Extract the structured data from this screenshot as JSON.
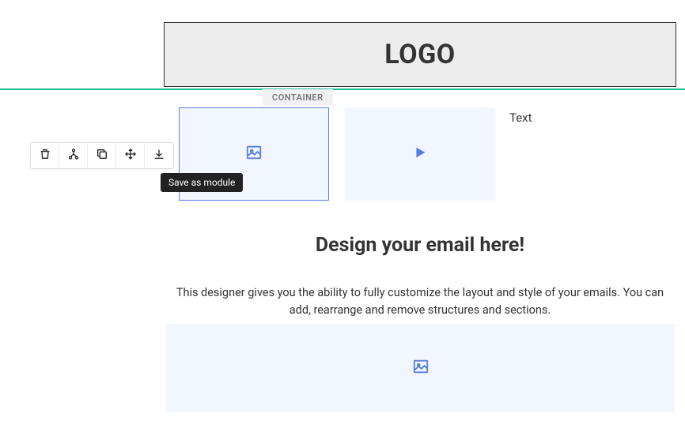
{
  "logo": {
    "text": "LOGO"
  },
  "selection": {
    "tag": "CONTAINER"
  },
  "blocks": {
    "image_icon": "image-icon",
    "video_icon": "play-icon",
    "text_label": "Text"
  },
  "toolbar": {
    "delete": "trash-icon",
    "tree": "tree-icon",
    "copy": "copy-icon",
    "move": "move-icon",
    "save": "download-icon"
  },
  "tooltip": {
    "save_module": "Save as module"
  },
  "content": {
    "heading": "Design your email here!",
    "description": "This designer gives you the ability to fully customize the layout and style of your emails. You can add, rearrange and remove structures and sections."
  }
}
